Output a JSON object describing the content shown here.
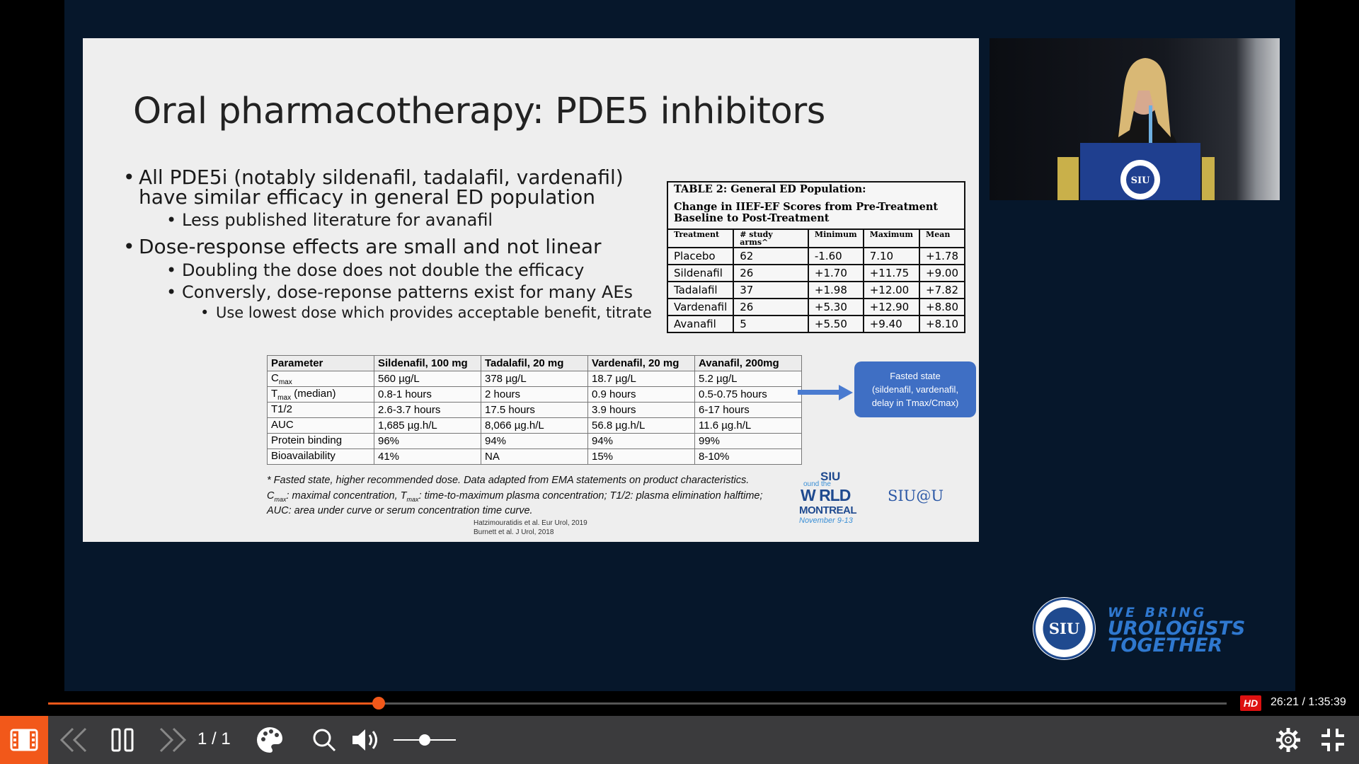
{
  "slide": {
    "title": "Oral pharmacotherapy: PDE5 inhibitors",
    "bullets": [
      {
        "level": 1,
        "text": "All PDE5i (notably sildenafil, tadalafil, vardenafil)"
      },
      {
        "level": 1,
        "text": "have similar efficacy in general ED population",
        "cont": true
      },
      {
        "level": 2,
        "text": "Less published literature for avanafil"
      },
      {
        "level": 1,
        "text": "Dose-response effects are small and not linear"
      },
      {
        "level": 2,
        "text": "Doubling the dose does not double the efficacy"
      },
      {
        "level": 2,
        "text": "Conversly, dose-reponse patterns exist for many AEs"
      },
      {
        "level": 3,
        "text": "Use lowest dose which provides acceptable benefit, titrate"
      }
    ],
    "table2": {
      "caption1": "TABLE 2: General ED Population:",
      "caption2": "Change in IIEF-EF Scores from Pre-Treatment Baseline to Post-Treatment",
      "headers": [
        "Treatment",
        "# study arms^",
        "Minimum",
        "Maximum",
        "Mean"
      ],
      "rows": [
        [
          "Placebo",
          "62",
          "-1.60",
          "7.10",
          "+1.78"
        ],
        [
          "Sildenafil",
          "26",
          "+1.70",
          "+11.75",
          "+9.00"
        ],
        [
          "Tadalafil",
          "37",
          "+1.98",
          "+12.00",
          "+7.82"
        ],
        [
          "Vardenafil",
          "26",
          "+5.30",
          "+12.90",
          "+8.80"
        ],
        [
          "Avanafil",
          "5",
          "+5.50",
          "+9.40",
          "+8.10"
        ]
      ]
    },
    "param_table": {
      "headers": [
        "Parameter",
        "Sildenafil, 100 mg",
        "Tadalafil, 20 mg",
        "Vardenafil, 20 mg",
        "Avanafil, 200mg"
      ],
      "rows": [
        {
          "param": "C",
          "sub": "max",
          "suffix": "",
          "values": [
            "560 µg/L",
            "378 µg/L",
            "18.7 µg/L",
            "5.2 µg/L"
          ]
        },
        {
          "param": "T",
          "sub": "max",
          "suffix": " (median)",
          "values": [
            "0.8-1 hours",
            "2 hours",
            "0.9 hours",
            "0.5-0.75 hours"
          ]
        },
        {
          "param": "T1/2",
          "sub": "",
          "suffix": "",
          "values": [
            "2.6-3.7 hours",
            "17.5 hours",
            "3.9 hours",
            "6-17 hours"
          ]
        },
        {
          "param": "AUC",
          "sub": "",
          "suffix": "",
          "values": [
            "1,685 µg.h/L",
            "8,066 µg.h/L",
            "56.8 µg.h/L",
            "11.6 µg.h/L"
          ]
        },
        {
          "param": "Protein binding",
          "sub": "",
          "suffix": "",
          "values": [
            "96%",
            "94%",
            "94%",
            "99%"
          ]
        },
        {
          "param": "Bioavailability",
          "sub": "",
          "suffix": "",
          "values": [
            "41%",
            "NA",
            "15%",
            "8-10%"
          ]
        }
      ]
    },
    "fasted_note": [
      "Fasted state",
      "(sildenafil, vardenafil,",
      "delay in Tmax/Cmax)"
    ],
    "footnote1": "* Fasted state, higher recommended dose. Data adapted from EMA statements on product characteristics.",
    "footnote2a": "C",
    "footnote2b": "max",
    "footnote2c": ": maximal concentration, T",
    "footnote2d": "max",
    "footnote2e": ": time-to-maximum plasma concentration; T1/2: plasma elimination halftime;",
    "footnote3": "AUC: area under curve or serum concentration time curve.",
    "ref1": "Hatzimouratidis et al. Eur Urol, 2019",
    "ref2": "Burnett et al. J Urol, 2018",
    "logo_world": [
      "SIU",
      "ound the",
      "W RLD",
      "MONTREAL",
      "November 9-13"
    ],
    "logo_at": "SIU@U"
  },
  "branding": {
    "seal_text": "SIU",
    "tagline": [
      "WE BRING",
      "UROLOGISTS",
      "TOGETHER"
    ]
  },
  "player": {
    "progress": 0.2803,
    "hd_label": "HD",
    "time": "26:21 / 1:35:39",
    "page": "1 / 1",
    "volume": 0.5,
    "accent": "#f2581a"
  }
}
